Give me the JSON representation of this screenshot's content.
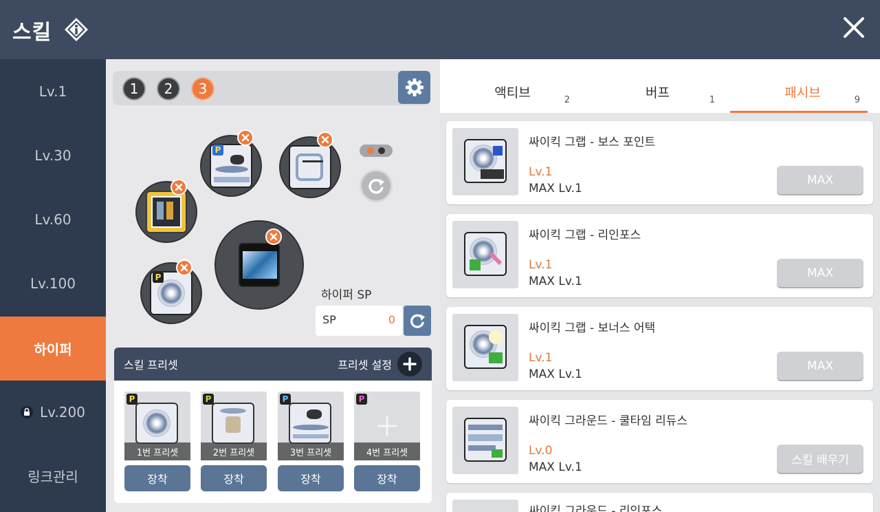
{
  "header": {
    "title": "스킬"
  },
  "nav": {
    "items": [
      {
        "label": "Lv.1"
      },
      {
        "label": "Lv.30"
      },
      {
        "label": "Lv.60"
      },
      {
        "label": "Lv.100"
      },
      {
        "label": "하이퍼",
        "active": true
      },
      {
        "label": "Lv.200",
        "locked": true
      },
      {
        "label": "링크관리"
      }
    ]
  },
  "presets_top": {
    "numbers": [
      "1",
      "2",
      "3"
    ],
    "active": "3"
  },
  "hyper_sp": {
    "title": "하이퍼 SP",
    "label": "SP",
    "value": "0"
  },
  "preset_panel": {
    "title": "스킬 프리셋",
    "settings_label": "프리셋 설정",
    "slots": [
      {
        "badge": "P",
        "caption": "1번 프리셋",
        "equip": "장착"
      },
      {
        "badge": "P",
        "caption": "2번 프리셋",
        "equip": "장착"
      },
      {
        "badge": "P",
        "caption": "3번 프리셋",
        "equip": "장착"
      },
      {
        "badge": "P",
        "caption": "4번 프리셋",
        "equip": "장착"
      }
    ]
  },
  "tabs": [
    {
      "label": "액티브",
      "count": "2"
    },
    {
      "label": "버프",
      "count": "1"
    },
    {
      "label": "패시브",
      "count": "9",
      "active": true
    }
  ],
  "skills": [
    {
      "name": "싸이킥 그랩 - 보스 포인트",
      "level": "Lv.1",
      "max": "MAX Lv.1",
      "button": "MAX"
    },
    {
      "name": "싸이킥 그랩 - 리인포스",
      "level": "Lv.1",
      "max": "MAX Lv.1",
      "button": "MAX"
    },
    {
      "name": "싸이킥 그랩 - 보너스 어택",
      "level": "Lv.1",
      "max": "MAX Lv.1",
      "button": "MAX"
    },
    {
      "name": "싸이킥 그라운드 - 쿨타임 리듀스",
      "level": "Lv.0",
      "max": "MAX Lv.1",
      "button": "스킬 배우기"
    },
    {
      "name": "싸이킥 그라운드 - 리인포스"
    }
  ],
  "colors": {
    "accent": "#ef7a3f",
    "header": "#3e4a5f",
    "nav": "#2e3a4d",
    "button": "#5a7595"
  },
  "icons": [
    "info-icon",
    "close-icon",
    "gear-icon",
    "refresh-icon",
    "lock-icon",
    "plus-icon",
    "remove-icon"
  ]
}
